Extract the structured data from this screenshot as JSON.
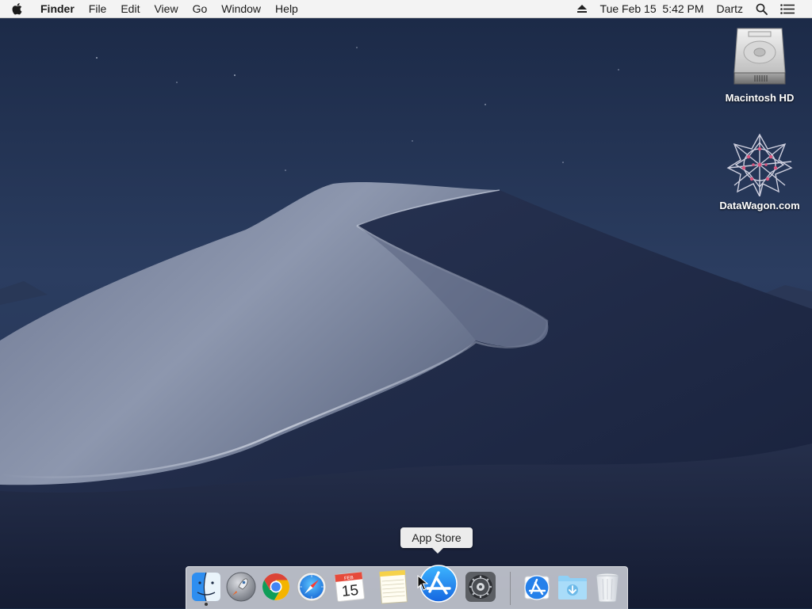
{
  "menubar": {
    "app_name": "Finder",
    "menus": [
      "File",
      "Edit",
      "View",
      "Go",
      "Window",
      "Help"
    ],
    "eject_icon": "eject-icon",
    "datetime": "Tue Feb 15  5:42 PM",
    "user": "Dartz",
    "search_icon": "spotlight-icon",
    "list_icon": "notification-center-icon"
  },
  "desktop": {
    "icons": [
      {
        "label": "Macintosh HD",
        "icon": "hard-drive-icon"
      },
      {
        "label": "DataWagon.com",
        "icon": "datawagon-logo-icon"
      }
    ]
  },
  "tooltip": {
    "text": "App Store"
  },
  "dock": {
    "apps": [
      {
        "name": "Finder",
        "icon": "finder-icon",
        "running": true
      },
      {
        "name": "Launchpad",
        "icon": "launchpad-icon",
        "running": false
      },
      {
        "name": "Google Chrome",
        "icon": "chrome-icon",
        "running": false
      },
      {
        "name": "Safari",
        "icon": "safari-icon",
        "running": false
      },
      {
        "name": "Calendar",
        "icon": "calendar-icon",
        "running": false,
        "month": "FEB",
        "day": "15"
      },
      {
        "name": "Notes",
        "icon": "notes-icon",
        "running": false
      },
      {
        "name": "App Store",
        "icon": "app-store-icon",
        "running": false
      },
      {
        "name": "System Preferences",
        "icon": "system-preferences-icon",
        "running": false
      }
    ],
    "stacks": [
      {
        "name": "Applications",
        "icon": "applications-folder-icon"
      },
      {
        "name": "Downloads",
        "icon": "downloads-folder-icon"
      },
      {
        "name": "Trash",
        "icon": "trash-icon"
      }
    ]
  },
  "colors": {
    "sky_top": "#1d2b48",
    "sky_bottom": "#2a3c60",
    "dune_light": "#9fa8bd",
    "dune_dark": "#1b2540",
    "menubar_bg": "#f3f3f3"
  }
}
